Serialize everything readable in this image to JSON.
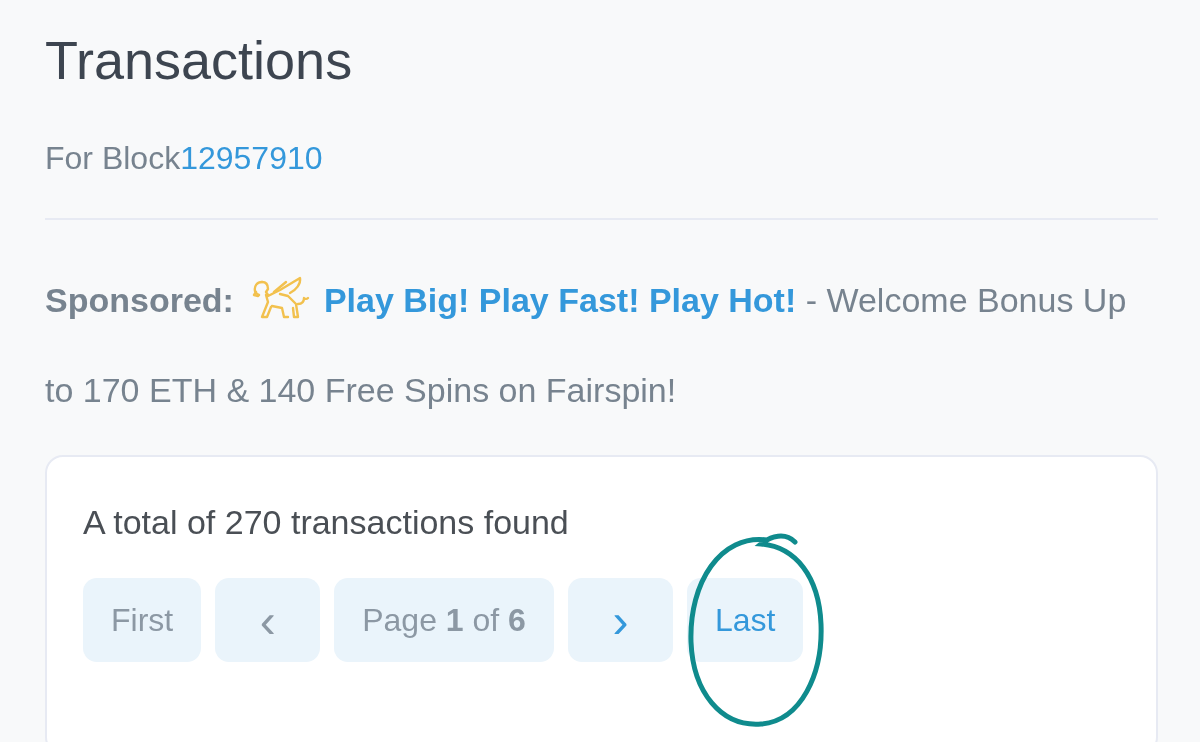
{
  "title": "Transactions",
  "subtitle": {
    "label": "For Block",
    "block": "12957910"
  },
  "sponsored": {
    "label": "Sponsored:",
    "link": "Play Big! Play Fast! Play Hot!",
    "text": "- Welcome Bonus Up to 170 ETH & 140 Free Spins on Fairspin!"
  },
  "card": {
    "summary": "A total of 270 transactions found",
    "pagination": [
      {
        "kind": "text",
        "label": "First",
        "disabled": true,
        "circled": false
      },
      {
        "kind": "prev",
        "label": "‹",
        "disabled": true,
        "circled": false
      },
      {
        "kind": "info",
        "label": "Page **1** of **6**",
        "disabled": true,
        "circled": false
      },
      {
        "kind": "next",
        "label": "›",
        "disabled": false,
        "circled": false
      },
      {
        "kind": "text",
        "label": "Last",
        "disabled": false,
        "circled": true
      }
    ]
  }
}
